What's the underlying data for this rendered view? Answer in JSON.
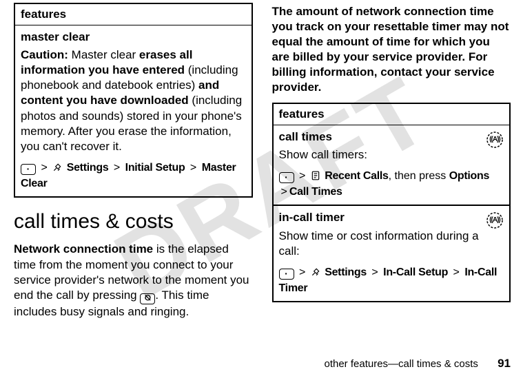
{
  "watermark": "DRAFT",
  "left": {
    "features_header": "features",
    "master_clear_title": "master clear",
    "caution_label": "Caution:",
    "caution_a": " Master clear ",
    "caution_b_bold": "erases all information you have entered",
    "caution_c": " (including phonebook and datebook entries) ",
    "caution_d_bold": "and content you have downloaded",
    "caution_e": " (including photos and sounds) stored in your phone's memory. After you erase the information, you can't recover it.",
    "crumb": {
      "settings": "Settings",
      "initial": "Initial Setup",
      "master": "Master Clear"
    },
    "section_title": "call times & costs",
    "para_bold": "Network connection time",
    "para_rest_a": " is the elapsed time from the moment you connect to your service provider's network to the moment you end the call by pressing ",
    "para_rest_b": ". This time includes busy signals and ringing."
  },
  "right": {
    "para_big": "The amount of network connection time you track on your resettable timer may not equal the amount of time for which you are billed by your service provider. For billing information, contact your service provider.",
    "features_header": "features",
    "row1_title": "call times",
    "row1_desc": "Show call timers:",
    "row1_crumb": {
      "recent": "Recent Calls",
      "mid": ", then press ",
      "options": "Options",
      "calltimes": "Call Times"
    },
    "row2_title": "in-call timer",
    "row2_desc": "Show time or cost information during a call:",
    "row2_crumb": {
      "settings": "Settings",
      "incall": "In-Call Setup",
      "timer": "In-Call Timer"
    }
  },
  "footer": {
    "text": "other features—call times & costs",
    "page": "91"
  }
}
